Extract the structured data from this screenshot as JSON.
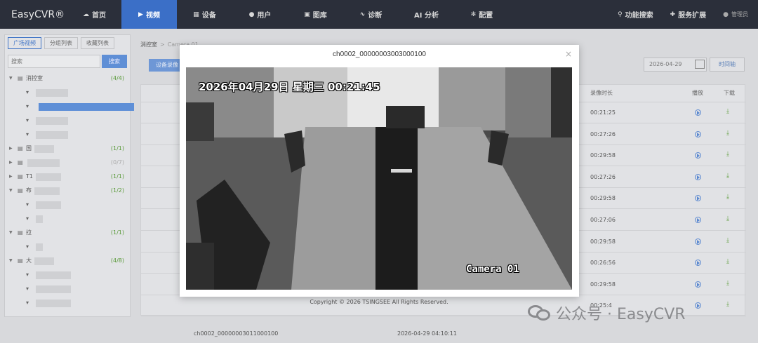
{
  "app": {
    "logo": "EasyCVR®"
  },
  "nav": {
    "items": [
      {
        "label": "首页",
        "icon": "cloud-icon",
        "active": false
      },
      {
        "label": "视频",
        "icon": "play-circle-icon",
        "active": true
      },
      {
        "label": "设备",
        "icon": "device-icon",
        "active": false
      },
      {
        "label": "用户",
        "icon": "user-icon",
        "active": false
      },
      {
        "label": "图库",
        "icon": "gallery-icon",
        "active": false
      },
      {
        "label": "诊断",
        "icon": "pulse-icon",
        "active": false
      },
      {
        "label": "AI 分析",
        "icon": "",
        "active": false
      },
      {
        "label": "配置",
        "icon": "gear-icon",
        "active": false
      }
    ],
    "right": {
      "func_search": "功能搜索",
      "service_ext": "服务扩展",
      "user": "管理员"
    }
  },
  "sidebar": {
    "tabs": [
      "广场视频",
      "分组列表",
      "收藏列表"
    ],
    "search_placeholder": "搜索",
    "search_button": "搜索",
    "tree": [
      {
        "name": "消控室",
        "count": "(4/4)",
        "level": 0,
        "expanded": true
      },
      {
        "name": "",
        "level": 1
      },
      {
        "name": "",
        "level": 1,
        "selected": true
      },
      {
        "name": "",
        "level": 1
      },
      {
        "name": "",
        "level": 1
      },
      {
        "name": "国",
        "count": "(1/1)",
        "level": 0
      },
      {
        "name": "",
        "count": "(0/7)",
        "level": 0,
        "grey": true
      },
      {
        "name": "T1",
        "count": "(1/1)",
        "level": 0
      },
      {
        "name": "布",
        "count": "(1/2)",
        "level": 0,
        "expanded": true
      },
      {
        "name": "",
        "level": 1
      },
      {
        "name": "",
        "level": 1
      },
      {
        "name": "拉",
        "count": "(1/1)",
        "level": 0,
        "expanded": true
      },
      {
        "name": "",
        "level": 1
      },
      {
        "name": "大",
        "count": "(4/8)",
        "level": 0,
        "expanded": true
      },
      {
        "name": "",
        "level": 1
      },
      {
        "name": "",
        "level": 1
      },
      {
        "name": "",
        "level": 1
      }
    ]
  },
  "breadcrumb": {
    "root": "消控室",
    "sep": ">",
    "current": "Camera 01"
  },
  "toolbar": {
    "device_record": "设备录像",
    "date": "2026-04-29",
    "timeline": "时间轴"
  },
  "table": {
    "headers": {
      "duration": "录像时长",
      "play": "播放",
      "download": "下载"
    },
    "durations": [
      "00:21:25",
      "00:27:26",
      "00:29:58",
      "00:27:26",
      "00:29:58",
      "00:27:06",
      "00:29:58",
      "00:26:56",
      "00:29:58",
      "00:25:4"
    ],
    "last_row": {
      "channel": "ch0002_00000003011000100",
      "start": "2026-04-29 04:10:11"
    }
  },
  "footer": "Copyright © 2026 TSINGSEE All Rights Reserved.",
  "watermark": "公众号 · EasyCVR",
  "modal": {
    "title": "ch0002_00000003003000100",
    "close": "×",
    "osd_time": "2026年04月29日  星期三  00:21:45",
    "osd_camera": "Camera 01"
  }
}
